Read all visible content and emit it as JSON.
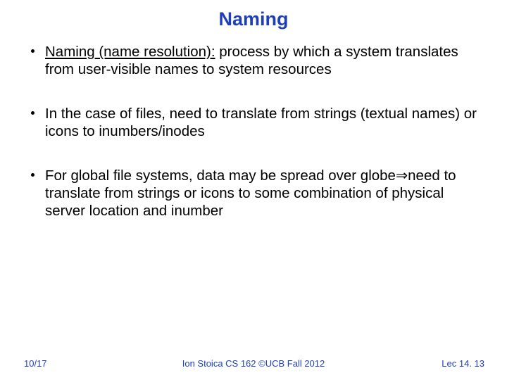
{
  "title": "Naming",
  "bullets": [
    {
      "lead": "Naming (name resolution):",
      "rest": " process by which a system translates from user-visible names to system resources"
    },
    {
      "lead": "",
      "rest": "In the case of files, need to translate from strings (textual names) or icons to inumbers/inodes"
    },
    {
      "lead": "",
      "restA": "For global file systems, data may be spread over globe",
      "arrow": "⇒",
      "restB": "need to translate from strings or icons to some combination of physical server location and inumber"
    }
  ],
  "footer": {
    "left": "10/17",
    "center": "Ion Stoica CS 162 ©UCB Fall 2012",
    "right": "Lec 14. 13"
  }
}
